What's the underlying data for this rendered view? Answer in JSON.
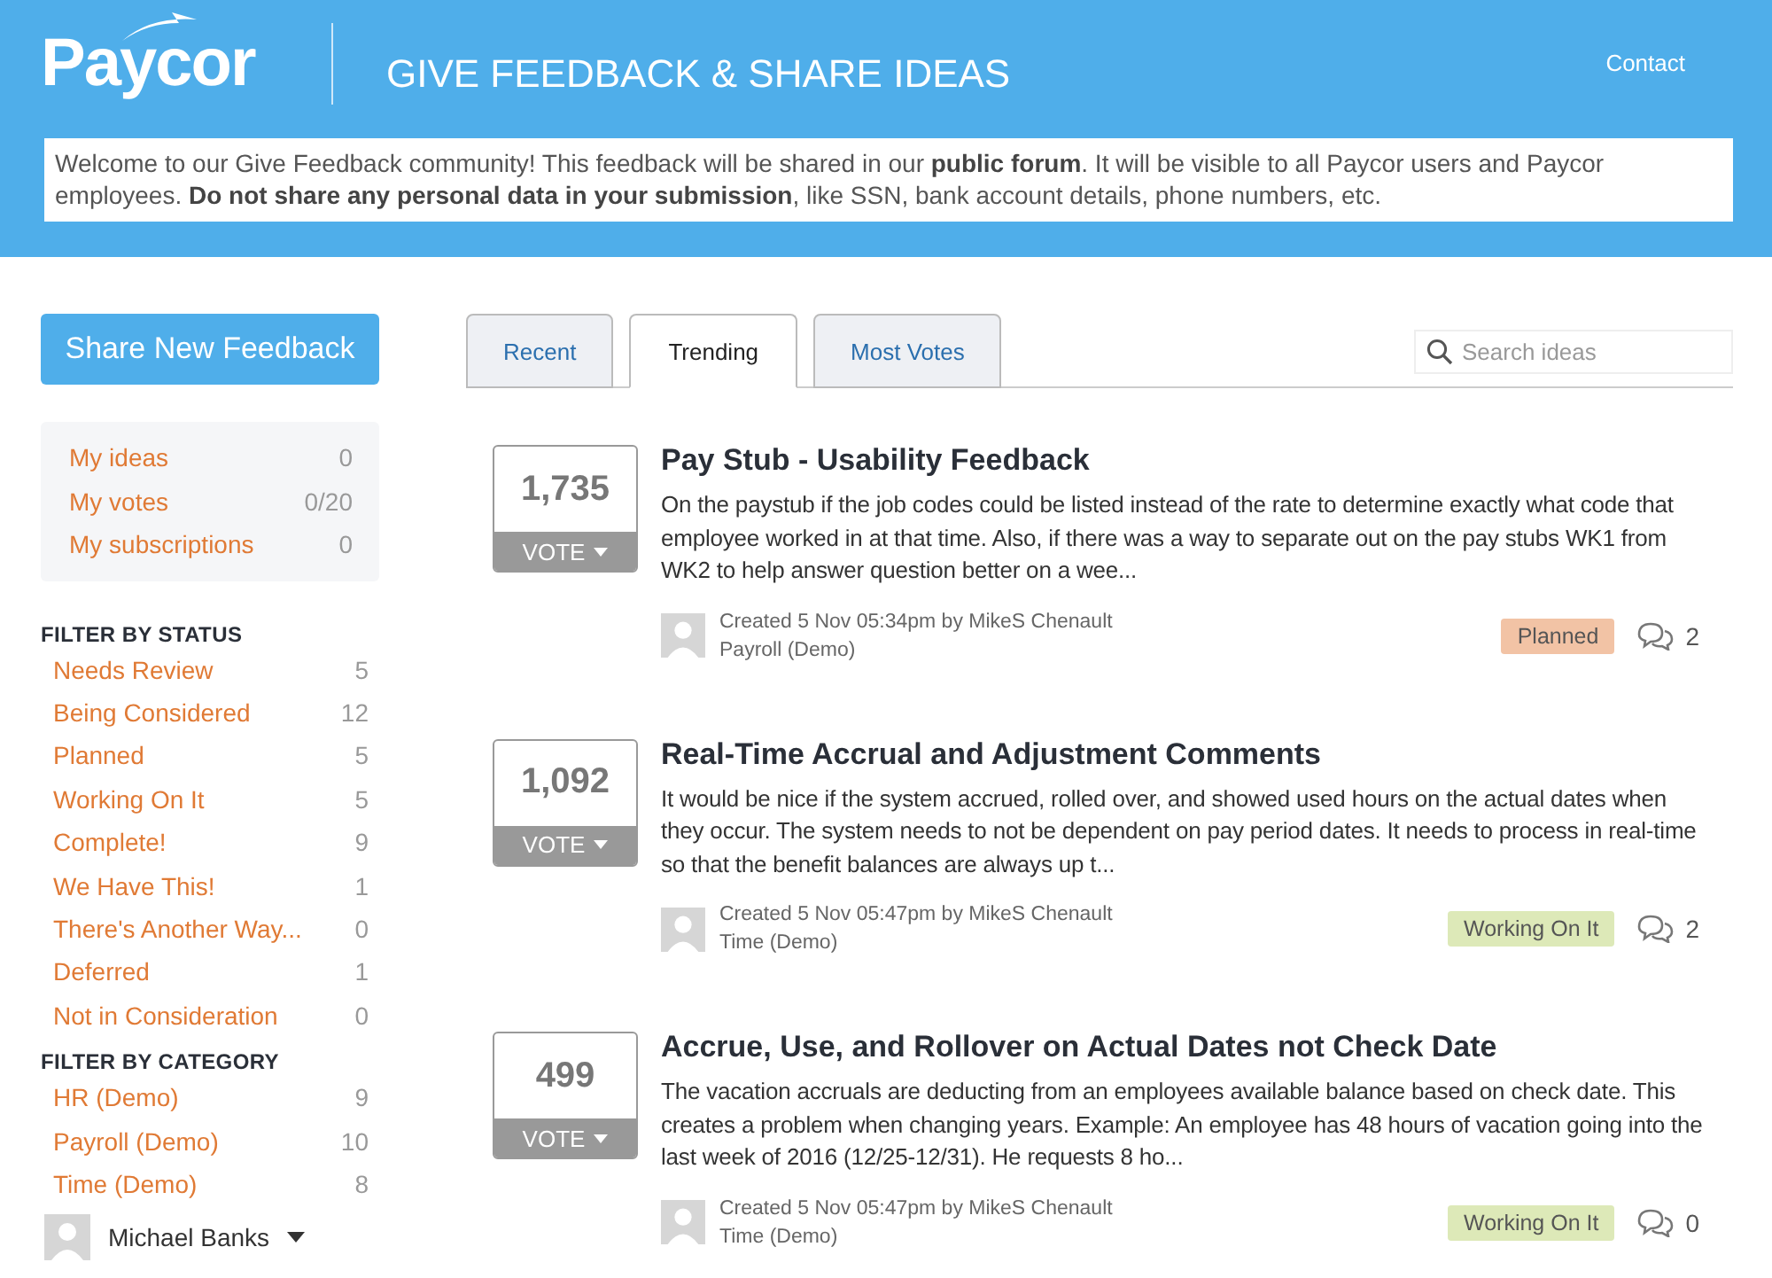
{
  "header": {
    "logo": "Paycor",
    "title": "GIVE FEEDBACK & SHARE IDEAS",
    "contact": "Contact"
  },
  "notice": "Welcome to our Give Feedback community! This feedback will be shared in our **public forum**. It will be visible to all Paycor users and Paycor employees. **Do not share any personal data in your submission**, like SSN, bank account details, phone numbers, etc.",
  "share_button": "Share New Feedback",
  "my_links": [
    {
      "label": "My ideas",
      "count": "0"
    },
    {
      "label": "My votes",
      "count": "0/20"
    },
    {
      "label": "My subscriptions",
      "count": "0"
    }
  ],
  "status_filter": {
    "heading": "FILTER BY STATUS",
    "items": [
      {
        "label": "Needs Review",
        "count": "5"
      },
      {
        "label": "Being Considered",
        "count": "12"
      },
      {
        "label": "Planned",
        "count": "5"
      },
      {
        "label": "Working On It",
        "count": "5"
      },
      {
        "label": "Complete!",
        "count": "9"
      },
      {
        "label": "We Have This!",
        "count": "1"
      },
      {
        "label": "There's Another Way...",
        "count": "0"
      },
      {
        "label": "Deferred",
        "count": "1"
      },
      {
        "label": "Not in Consideration",
        "count": "0"
      }
    ]
  },
  "category_filter": {
    "heading": "FILTER BY CATEGORY",
    "items": [
      {
        "label": "HR (Demo)",
        "count": "9"
      },
      {
        "label": "Payroll (Demo)",
        "count": "10"
      },
      {
        "label": "Time (Demo)",
        "count": "8"
      }
    ]
  },
  "user": {
    "name": "Michael Banks"
  },
  "tabs": [
    {
      "label": "Recent",
      "selected": false
    },
    {
      "label": "Trending",
      "selected": true
    },
    {
      "label": "Most Votes",
      "selected": false
    }
  ],
  "search": {
    "placeholder": "Search ideas"
  },
  "ideas": [
    {
      "votes": "1,735",
      "vote_label": "VOTE",
      "title": "Pay Stub - Usability Feedback",
      "description": "On the paystub if the job codes could be listed instead of the rate to determine exactly what code that employee worked in at that time. Also, if there was a way to separate out on the pay stubs WK1 from WK2 to help answer question better on a wee...",
      "created": "Created 5 Nov 05:34pm by MikeS Chenault",
      "category": "Payroll (Demo)",
      "status": "Planned",
      "color": "#f2c3a5",
      "comments": "2"
    },
    {
      "votes": "1,092",
      "vote_label": "VOTE",
      "title": "Real-Time Accrual and Adjustment Comments",
      "description": "It would be nice if the system accrued, rolled over, and showed used hours on the actual dates when they occur. The system needs to not be dependent on pay period dates. It needs to process in real-time so that the benefit balances are always up t...",
      "created": "Created 5 Nov 05:47pm by MikeS Chenault",
      "category": "Time (Demo)",
      "status": "Working On It",
      "color": "#dde9b8",
      "comments": "2"
    },
    {
      "votes": "499",
      "vote_label": "VOTE",
      "title": "Accrue, Use, and Rollover on Actual Dates not Check Date",
      "description": "The vacation accruals are deducting from an employees available balance based on check date. This creates a problem when changing years. Example: An employee has 48 hours of vacation going into the last week of 2016 (12/25-12/31). He requests 8 ho...",
      "created": "Created 5 Nov 05:47pm by MikeS Chenault",
      "category": "Time (Demo)",
      "status": "Working On It",
      "color": "#dde9b8",
      "comments": "0"
    }
  ]
}
